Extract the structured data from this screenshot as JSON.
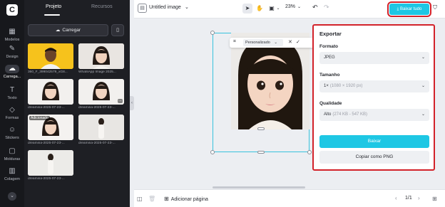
{
  "app": {
    "logo_glyph": "C",
    "rail": [
      {
        "label": "Modelos",
        "icon": "layout-icon",
        "glyph": "▦"
      },
      {
        "label": "Design",
        "icon": "palette-icon",
        "glyph": "✎"
      },
      {
        "label": "Carrega...",
        "icon": "upload-cloud-icon",
        "glyph": "☁"
      },
      {
        "label": "Texto",
        "icon": "text-icon",
        "glyph": "T"
      },
      {
        "label": "Formas",
        "icon": "shapes-icon",
        "glyph": "◇"
      },
      {
        "label": "Stickers",
        "icon": "sticker-icon",
        "glyph": "☺"
      },
      {
        "label": "Molduras",
        "icon": "frame-icon",
        "glyph": "▢"
      },
      {
        "label": "Colagem",
        "icon": "collage-icon",
        "glyph": "▥"
      }
    ]
  },
  "panel": {
    "tabs": [
      {
        "label": "Projeto",
        "active": true
      },
      {
        "label": "Recursos",
        "active": false
      }
    ],
    "upload_label": "Carregar",
    "assets": [
      {
        "caption": "360_F_399042579_xG8...",
        "bg": "#f6c21c",
        "badge": ""
      },
      {
        "caption": "WhatsApp Image 2025...",
        "bg": "#e9e5e1",
        "badge": ""
      },
      {
        "caption": "dreamina-2025-07-23-...",
        "bg": "#f2f0ee",
        "badge": ""
      },
      {
        "caption": "dreamina-2025-07-23-...",
        "bg": "#f2f0ee",
        "badge": ""
      },
      {
        "caption": "dreamina-2025-07-23-...",
        "bg": "#f4f2f0",
        "badge": "Adicionado"
      },
      {
        "caption": "dreamina-2025-07-23-...",
        "bg": "#e8e6e3",
        "badge": ""
      },
      {
        "caption": "dreamina-2025-07-23-...",
        "bg": "#ecebe8",
        "badge": ""
      }
    ]
  },
  "topbar": {
    "title": "Untitled image",
    "zoom": "23%",
    "download_all": "Baixar tudo"
  },
  "toolbar": {
    "preset": "Personalizado"
  },
  "export": {
    "title": "Exportar",
    "format_label": "Formato",
    "format_value": "JPEG",
    "size_label": "Tamanho",
    "size_value": "1×",
    "size_detail": "(1080 × 1920 px)",
    "quality_label": "Qualidade",
    "quality_value": "Alto",
    "quality_detail": "(274 KB - 547 KB)",
    "primary_button": "Baixar",
    "secondary_button": "Copiar como PNG"
  },
  "bottombar": {
    "add_page": "Adicionar página",
    "page_indicator": "1/1"
  },
  "colors": {
    "accent": "#1ec7e4",
    "highlight": "#d3222a",
    "rail_bg": "#17181c",
    "panel_bg": "#1e1f24"
  }
}
